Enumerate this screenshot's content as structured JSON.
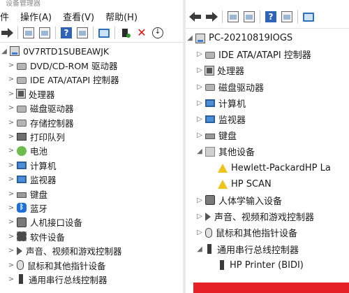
{
  "left": {
    "title_fragment": "设备管理器",
    "menu": [
      "操作(A)",
      "查看(V)",
      "帮助(H)"
    ],
    "menu_partial": "件",
    "toolbar_icons": [
      "forward-arrow-icon",
      "window-icon",
      "properties-icon",
      "help-icon",
      "window-icon",
      "monitor-icon",
      "scan-hardware-icon",
      "uninstall-x-icon",
      "download-driver-icon"
    ],
    "root": "0V7RTD1SUBEAWJK",
    "items": [
      {
        "label": "DVD/CD-ROM 驱动器",
        "icon": "dvd-icon"
      },
      {
        "label": "IDE ATA/ATAPI 控制器",
        "icon": "ide-controller-icon"
      },
      {
        "label": "处理器",
        "icon": "processor-icon"
      },
      {
        "label": "磁盘驱动器",
        "icon": "disk-drive-icon"
      },
      {
        "label": "存储控制器",
        "icon": "storage-controller-icon"
      },
      {
        "label": "打印队列",
        "icon": "print-queue-icon"
      },
      {
        "label": "电池",
        "icon": "battery-icon"
      },
      {
        "label": "计算机",
        "icon": "computer-icon"
      },
      {
        "label": "监视器",
        "icon": "monitor-icon"
      },
      {
        "label": "键盘",
        "icon": "keyboard-icon"
      },
      {
        "label": "蓝牙",
        "icon": "bluetooth-icon"
      },
      {
        "label": "人机接口设备",
        "icon": "hid-icon"
      },
      {
        "label": "软件设备",
        "icon": "software-device-icon"
      },
      {
        "label": "声音、视频和游戏控制器",
        "icon": "speaker-icon"
      },
      {
        "label": "鼠标和其他指针设备",
        "icon": "mouse-icon"
      },
      {
        "label": "通用串行总线控制器",
        "icon": "usb-icon"
      }
    ]
  },
  "right": {
    "toolbar_icons": [
      "back-arrow-icon",
      "forward-arrow-icon",
      "window-icon",
      "properties-icon",
      "help-icon",
      "window-icon",
      "monitor-icon"
    ],
    "root": "PC-20210819IOGS",
    "items": [
      {
        "label": "IDE ATA/ATAPI 控制器",
        "icon": "ide-controller-icon",
        "level": 1,
        "exp": "▷"
      },
      {
        "label": "处理器",
        "icon": "processor-icon",
        "level": 1,
        "exp": "▷"
      },
      {
        "label": "磁盘驱动器",
        "icon": "disk-drive-icon",
        "level": 1,
        "exp": "▷"
      },
      {
        "label": "计算机",
        "icon": "computer-icon",
        "level": 1,
        "exp": "▷"
      },
      {
        "label": "监视器",
        "icon": "monitor-icon",
        "level": 1,
        "exp": "▷"
      },
      {
        "label": "键盘",
        "icon": "keyboard-icon",
        "level": 1,
        "exp": "▷"
      },
      {
        "label": "其他设备",
        "icon": "other-devices-icon",
        "level": 1,
        "exp": "◢"
      },
      {
        "label": "Hewlett-PackardHP La",
        "icon": "warning-icon",
        "level": 2,
        "exp": ""
      },
      {
        "label": "HP SCAN",
        "icon": "warning-icon",
        "level": 2,
        "exp": ""
      },
      {
        "label": "人体学输入设备",
        "icon": "hid-icon",
        "level": 1,
        "exp": "▷"
      },
      {
        "label": "声音、视频和游戏控制器",
        "icon": "speaker-icon",
        "level": 1,
        "exp": "▷"
      },
      {
        "label": "鼠标和其他指针设备",
        "icon": "mouse-icon",
        "level": 1,
        "exp": "▷"
      },
      {
        "label": "通用串行总线控制器",
        "icon": "usb-icon",
        "level": 1,
        "exp": "◢"
      },
      {
        "label": "HP Printer (BIDI)",
        "icon": "usb-icon",
        "level": 2,
        "exp": ""
      }
    ]
  },
  "colors": {
    "accent_red": "#e52027",
    "tree_line": "#6a6a6a"
  }
}
